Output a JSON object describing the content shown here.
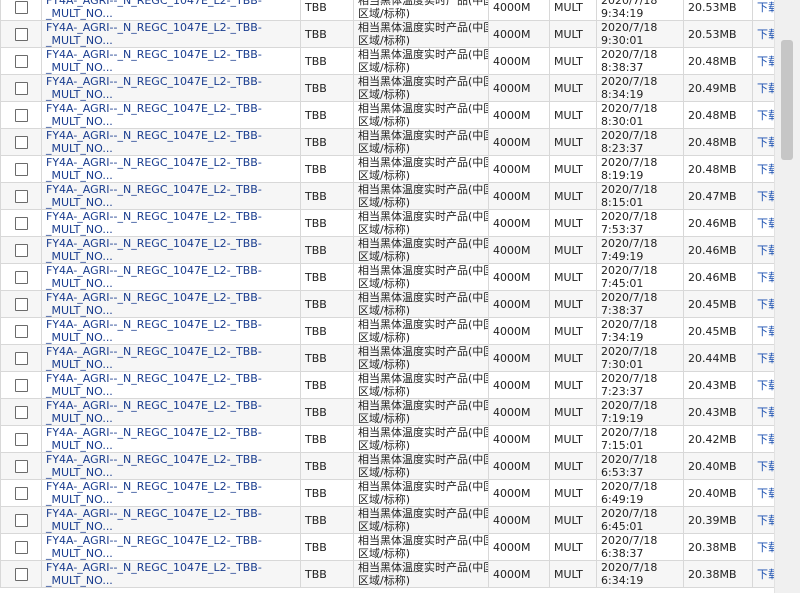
{
  "table": {
    "rows": [
      {
        "name_line1": "FY4A-_AGRI--_N_REGC_1047E_L2-_TBB-",
        "name_line2": "_MULT_NO...",
        "type": "TBB",
        "desc_line1": "相当黑体温度实时产品(中国",
        "desc_line2": "区域/标称)",
        "resolution": "4000M",
        "band": "MULT",
        "date": "2020/7/18",
        "time": "9:34:19",
        "size": "20.53MB",
        "download": "下载"
      },
      {
        "name_line1": "FY4A-_AGRI--_N_REGC_1047E_L2-_TBB-",
        "name_line2": "_MULT_NO...",
        "type": "TBB",
        "desc_line1": "相当黑体温度实时产品(中国",
        "desc_line2": "区域/标称)",
        "resolution": "4000M",
        "band": "MULT",
        "date": "2020/7/18",
        "time": "9:30:01",
        "size": "20.53MB",
        "download": "下载"
      },
      {
        "name_line1": "FY4A-_AGRI--_N_REGC_1047E_L2-_TBB-",
        "name_line2": "_MULT_NO...",
        "type": "TBB",
        "desc_line1": "相当黑体温度实时产品(中国",
        "desc_line2": "区域/标称)",
        "resolution": "4000M",
        "band": "MULT",
        "date": "2020/7/18",
        "time": "8:38:37",
        "size": "20.48MB",
        "download": "下载"
      },
      {
        "name_line1": "FY4A-_AGRI--_N_REGC_1047E_L2-_TBB-",
        "name_line2": "_MULT_NO...",
        "type": "TBB",
        "desc_line1": "相当黑体温度实时产品(中国",
        "desc_line2": "区域/标称)",
        "resolution": "4000M",
        "band": "MULT",
        "date": "2020/7/18",
        "time": "8:34:19",
        "size": "20.49MB",
        "download": "下载"
      },
      {
        "name_line1": "FY4A-_AGRI--_N_REGC_1047E_L2-_TBB-",
        "name_line2": "_MULT_NO...",
        "type": "TBB",
        "desc_line1": "相当黑体温度实时产品(中国",
        "desc_line2": "区域/标称)",
        "resolution": "4000M",
        "band": "MULT",
        "date": "2020/7/18",
        "time": "8:30:01",
        "size": "20.48MB",
        "download": "下载"
      },
      {
        "name_line1": "FY4A-_AGRI--_N_REGC_1047E_L2-_TBB-",
        "name_line2": "_MULT_NO...",
        "type": "TBB",
        "desc_line1": "相当黑体温度实时产品(中国",
        "desc_line2": "区域/标称)",
        "resolution": "4000M",
        "band": "MULT",
        "date": "2020/7/18",
        "time": "8:23:37",
        "size": "20.48MB",
        "download": "下载"
      },
      {
        "name_line1": "FY4A-_AGRI--_N_REGC_1047E_L2-_TBB-",
        "name_line2": "_MULT_NO...",
        "type": "TBB",
        "desc_line1": "相当黑体温度实时产品(中国",
        "desc_line2": "区域/标称)",
        "resolution": "4000M",
        "band": "MULT",
        "date": "2020/7/18",
        "time": "8:19:19",
        "size": "20.48MB",
        "download": "下载"
      },
      {
        "name_line1": "FY4A-_AGRI--_N_REGC_1047E_L2-_TBB-",
        "name_line2": "_MULT_NO...",
        "type": "TBB",
        "desc_line1": "相当黑体温度实时产品(中国",
        "desc_line2": "区域/标称)",
        "resolution": "4000M",
        "band": "MULT",
        "date": "2020/7/18",
        "time": "8:15:01",
        "size": "20.47MB",
        "download": "下载"
      },
      {
        "name_line1": "FY4A-_AGRI--_N_REGC_1047E_L2-_TBB-",
        "name_line2": "_MULT_NO...",
        "type": "TBB",
        "desc_line1": "相当黑体温度实时产品(中国",
        "desc_line2": "区域/标称)",
        "resolution": "4000M",
        "band": "MULT",
        "date": "2020/7/18",
        "time": "7:53:37",
        "size": "20.46MB",
        "download": "下载"
      },
      {
        "name_line1": "FY4A-_AGRI--_N_REGC_1047E_L2-_TBB-",
        "name_line2": "_MULT_NO...",
        "type": "TBB",
        "desc_line1": "相当黑体温度实时产品(中国",
        "desc_line2": "区域/标称)",
        "resolution": "4000M",
        "band": "MULT",
        "date": "2020/7/18",
        "time": "7:49:19",
        "size": "20.46MB",
        "download": "下载"
      },
      {
        "name_line1": "FY4A-_AGRI--_N_REGC_1047E_L2-_TBB-",
        "name_line2": "_MULT_NO...",
        "type": "TBB",
        "desc_line1": "相当黑体温度实时产品(中国",
        "desc_line2": "区域/标称)",
        "resolution": "4000M",
        "band": "MULT",
        "date": "2020/7/18",
        "time": "7:45:01",
        "size": "20.46MB",
        "download": "下载"
      },
      {
        "name_line1": "FY4A-_AGRI--_N_REGC_1047E_L2-_TBB-",
        "name_line2": "_MULT_NO...",
        "type": "TBB",
        "desc_line1": "相当黑体温度实时产品(中国",
        "desc_line2": "区域/标称)",
        "resolution": "4000M",
        "band": "MULT",
        "date": "2020/7/18",
        "time": "7:38:37",
        "size": "20.45MB",
        "download": "下载"
      },
      {
        "name_line1": "FY4A-_AGRI--_N_REGC_1047E_L2-_TBB-",
        "name_line2": "_MULT_NO...",
        "type": "TBB",
        "desc_line1": "相当黑体温度实时产品(中国",
        "desc_line2": "区域/标称)",
        "resolution": "4000M",
        "band": "MULT",
        "date": "2020/7/18",
        "time": "7:34:19",
        "size": "20.45MB",
        "download": "下载"
      },
      {
        "name_line1": "FY4A-_AGRI--_N_REGC_1047E_L2-_TBB-",
        "name_line2": "_MULT_NO...",
        "type": "TBB",
        "desc_line1": "相当黑体温度实时产品(中国",
        "desc_line2": "区域/标称)",
        "resolution": "4000M",
        "band": "MULT",
        "date": "2020/7/18",
        "time": "7:30:01",
        "size": "20.44MB",
        "download": "下载"
      },
      {
        "name_line1": "FY4A-_AGRI--_N_REGC_1047E_L2-_TBB-",
        "name_line2": "_MULT_NO...",
        "type": "TBB",
        "desc_line1": "相当黑体温度实时产品(中国",
        "desc_line2": "区域/标称)",
        "resolution": "4000M",
        "band": "MULT",
        "date": "2020/7/18",
        "time": "7:23:37",
        "size": "20.43MB",
        "download": "下载"
      },
      {
        "name_line1": "FY4A-_AGRI--_N_REGC_1047E_L2-_TBB-",
        "name_line2": "_MULT_NO...",
        "type": "TBB",
        "desc_line1": "相当黑体温度实时产品(中国",
        "desc_line2": "区域/标称)",
        "resolution": "4000M",
        "band": "MULT",
        "date": "2020/7/18",
        "time": "7:19:19",
        "size": "20.43MB",
        "download": "下载"
      },
      {
        "name_line1": "FY4A-_AGRI--_N_REGC_1047E_L2-_TBB-",
        "name_line2": "_MULT_NO...",
        "type": "TBB",
        "desc_line1": "相当黑体温度实时产品(中国",
        "desc_line2": "区域/标称)",
        "resolution": "4000M",
        "band": "MULT",
        "date": "2020/7/18",
        "time": "7:15:01",
        "size": "20.42MB",
        "download": "下载"
      },
      {
        "name_line1": "FY4A-_AGRI--_N_REGC_1047E_L2-_TBB-",
        "name_line2": "_MULT_NO...",
        "type": "TBB",
        "desc_line1": "相当黑体温度实时产品(中国",
        "desc_line2": "区域/标称)",
        "resolution": "4000M",
        "band": "MULT",
        "date": "2020/7/18",
        "time": "6:53:37",
        "size": "20.40MB",
        "download": "下载"
      },
      {
        "name_line1": "FY4A-_AGRI--_N_REGC_1047E_L2-_TBB-",
        "name_line2": "_MULT_NO...",
        "type": "TBB",
        "desc_line1": "相当黑体温度实时产品(中国",
        "desc_line2": "区域/标称)",
        "resolution": "4000M",
        "band": "MULT",
        "date": "2020/7/18",
        "time": "6:49:19",
        "size": "20.40MB",
        "download": "下载"
      },
      {
        "name_line1": "FY4A-_AGRI--_N_REGC_1047E_L2-_TBB-",
        "name_line2": "_MULT_NO...",
        "type": "TBB",
        "desc_line1": "相当黑体温度实时产品(中国",
        "desc_line2": "区域/标称)",
        "resolution": "4000M",
        "band": "MULT",
        "date": "2020/7/18",
        "time": "6:45:01",
        "size": "20.39MB",
        "download": "下载"
      },
      {
        "name_line1": "FY4A-_AGRI--_N_REGC_1047E_L2-_TBB-",
        "name_line2": "_MULT_NO...",
        "type": "TBB",
        "desc_line1": "相当黑体温度实时产品(中国",
        "desc_line2": "区域/标称)",
        "resolution": "4000M",
        "band": "MULT",
        "date": "2020/7/18",
        "time": "6:38:37",
        "size": "20.38MB",
        "download": "下载"
      },
      {
        "name_line1": "FY4A-_AGRI--_N_REGC_1047E_L2-_TBB-",
        "name_line2": "_MULT_NO...",
        "type": "TBB",
        "desc_line1": "相当黑体温度实时产品(中国",
        "desc_line2": "区域/标称)",
        "resolution": "4000M",
        "band": "MULT",
        "date": "2020/7/18",
        "time": "6:34:19",
        "size": "20.38MB",
        "download": "下载"
      }
    ]
  },
  "colors": {
    "link": "#1a3d8f",
    "row_alt": "#f6f6f6",
    "border": "#d8d8d8"
  }
}
